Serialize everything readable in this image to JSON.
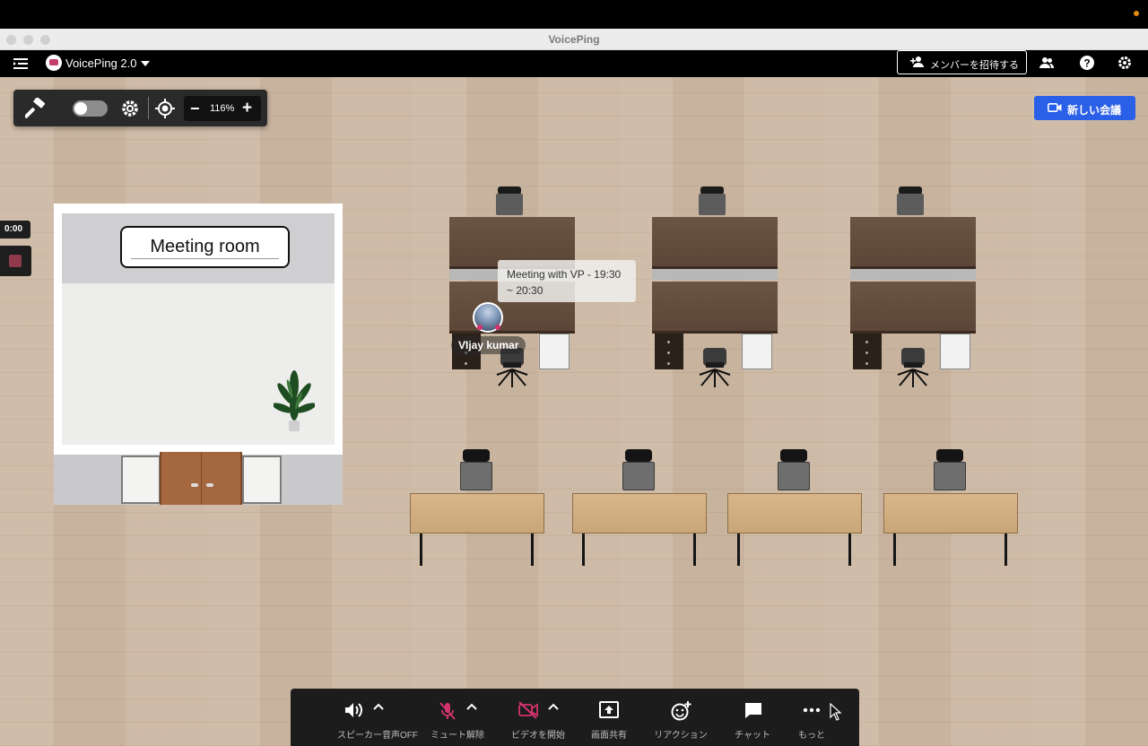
{
  "window": {
    "title": "VoicePing"
  },
  "header": {
    "app_name": "VoicePing 2.0",
    "invite_label": "メンバーを招待する"
  },
  "toolbar": {
    "zoom": "116%",
    "zoom_minus": "−",
    "zoom_plus": "+"
  },
  "new_meeting_label": "新しい会議",
  "recording": {
    "time": "0:00"
  },
  "meeting_room": {
    "label": "Meeting room"
  },
  "avatar": {
    "name": "VIjay kumar",
    "status": "Meeting with VP - 19:30 ~ 20:30"
  },
  "controls": {
    "speaker_label": "スピーカー音声OFF",
    "mute_label": "ミュート解除",
    "video_label": "ビデオを開始",
    "share_label": "画面共有",
    "reaction_label": "リアクション",
    "chat_label": "チャット",
    "more_label": "もっと"
  },
  "colors": {
    "accent": "#2a5fe8",
    "muted_red": "#d3336d",
    "toolbar_bg": "#2a2a2a",
    "floor": "#cdb9a4"
  }
}
